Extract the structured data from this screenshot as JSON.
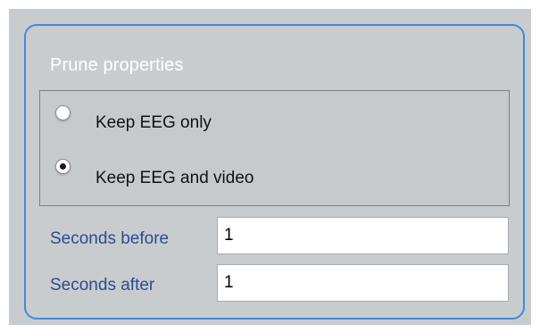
{
  "group": {
    "title": "Prune properties"
  },
  "radio_options": [
    {
      "label": "Keep EEG only",
      "selected": false
    },
    {
      "label": "Keep EEG and video",
      "selected": true
    }
  ],
  "fields": {
    "seconds_before": {
      "label": "Seconds before",
      "value": "1"
    },
    "seconds_after": {
      "label": "Seconds after",
      "value": "1"
    }
  },
  "colors": {
    "group_border": "#3f88e0",
    "panel_background": "#c9cccf",
    "field_label": "#2c4c8f",
    "group_title": "#ffffff"
  }
}
